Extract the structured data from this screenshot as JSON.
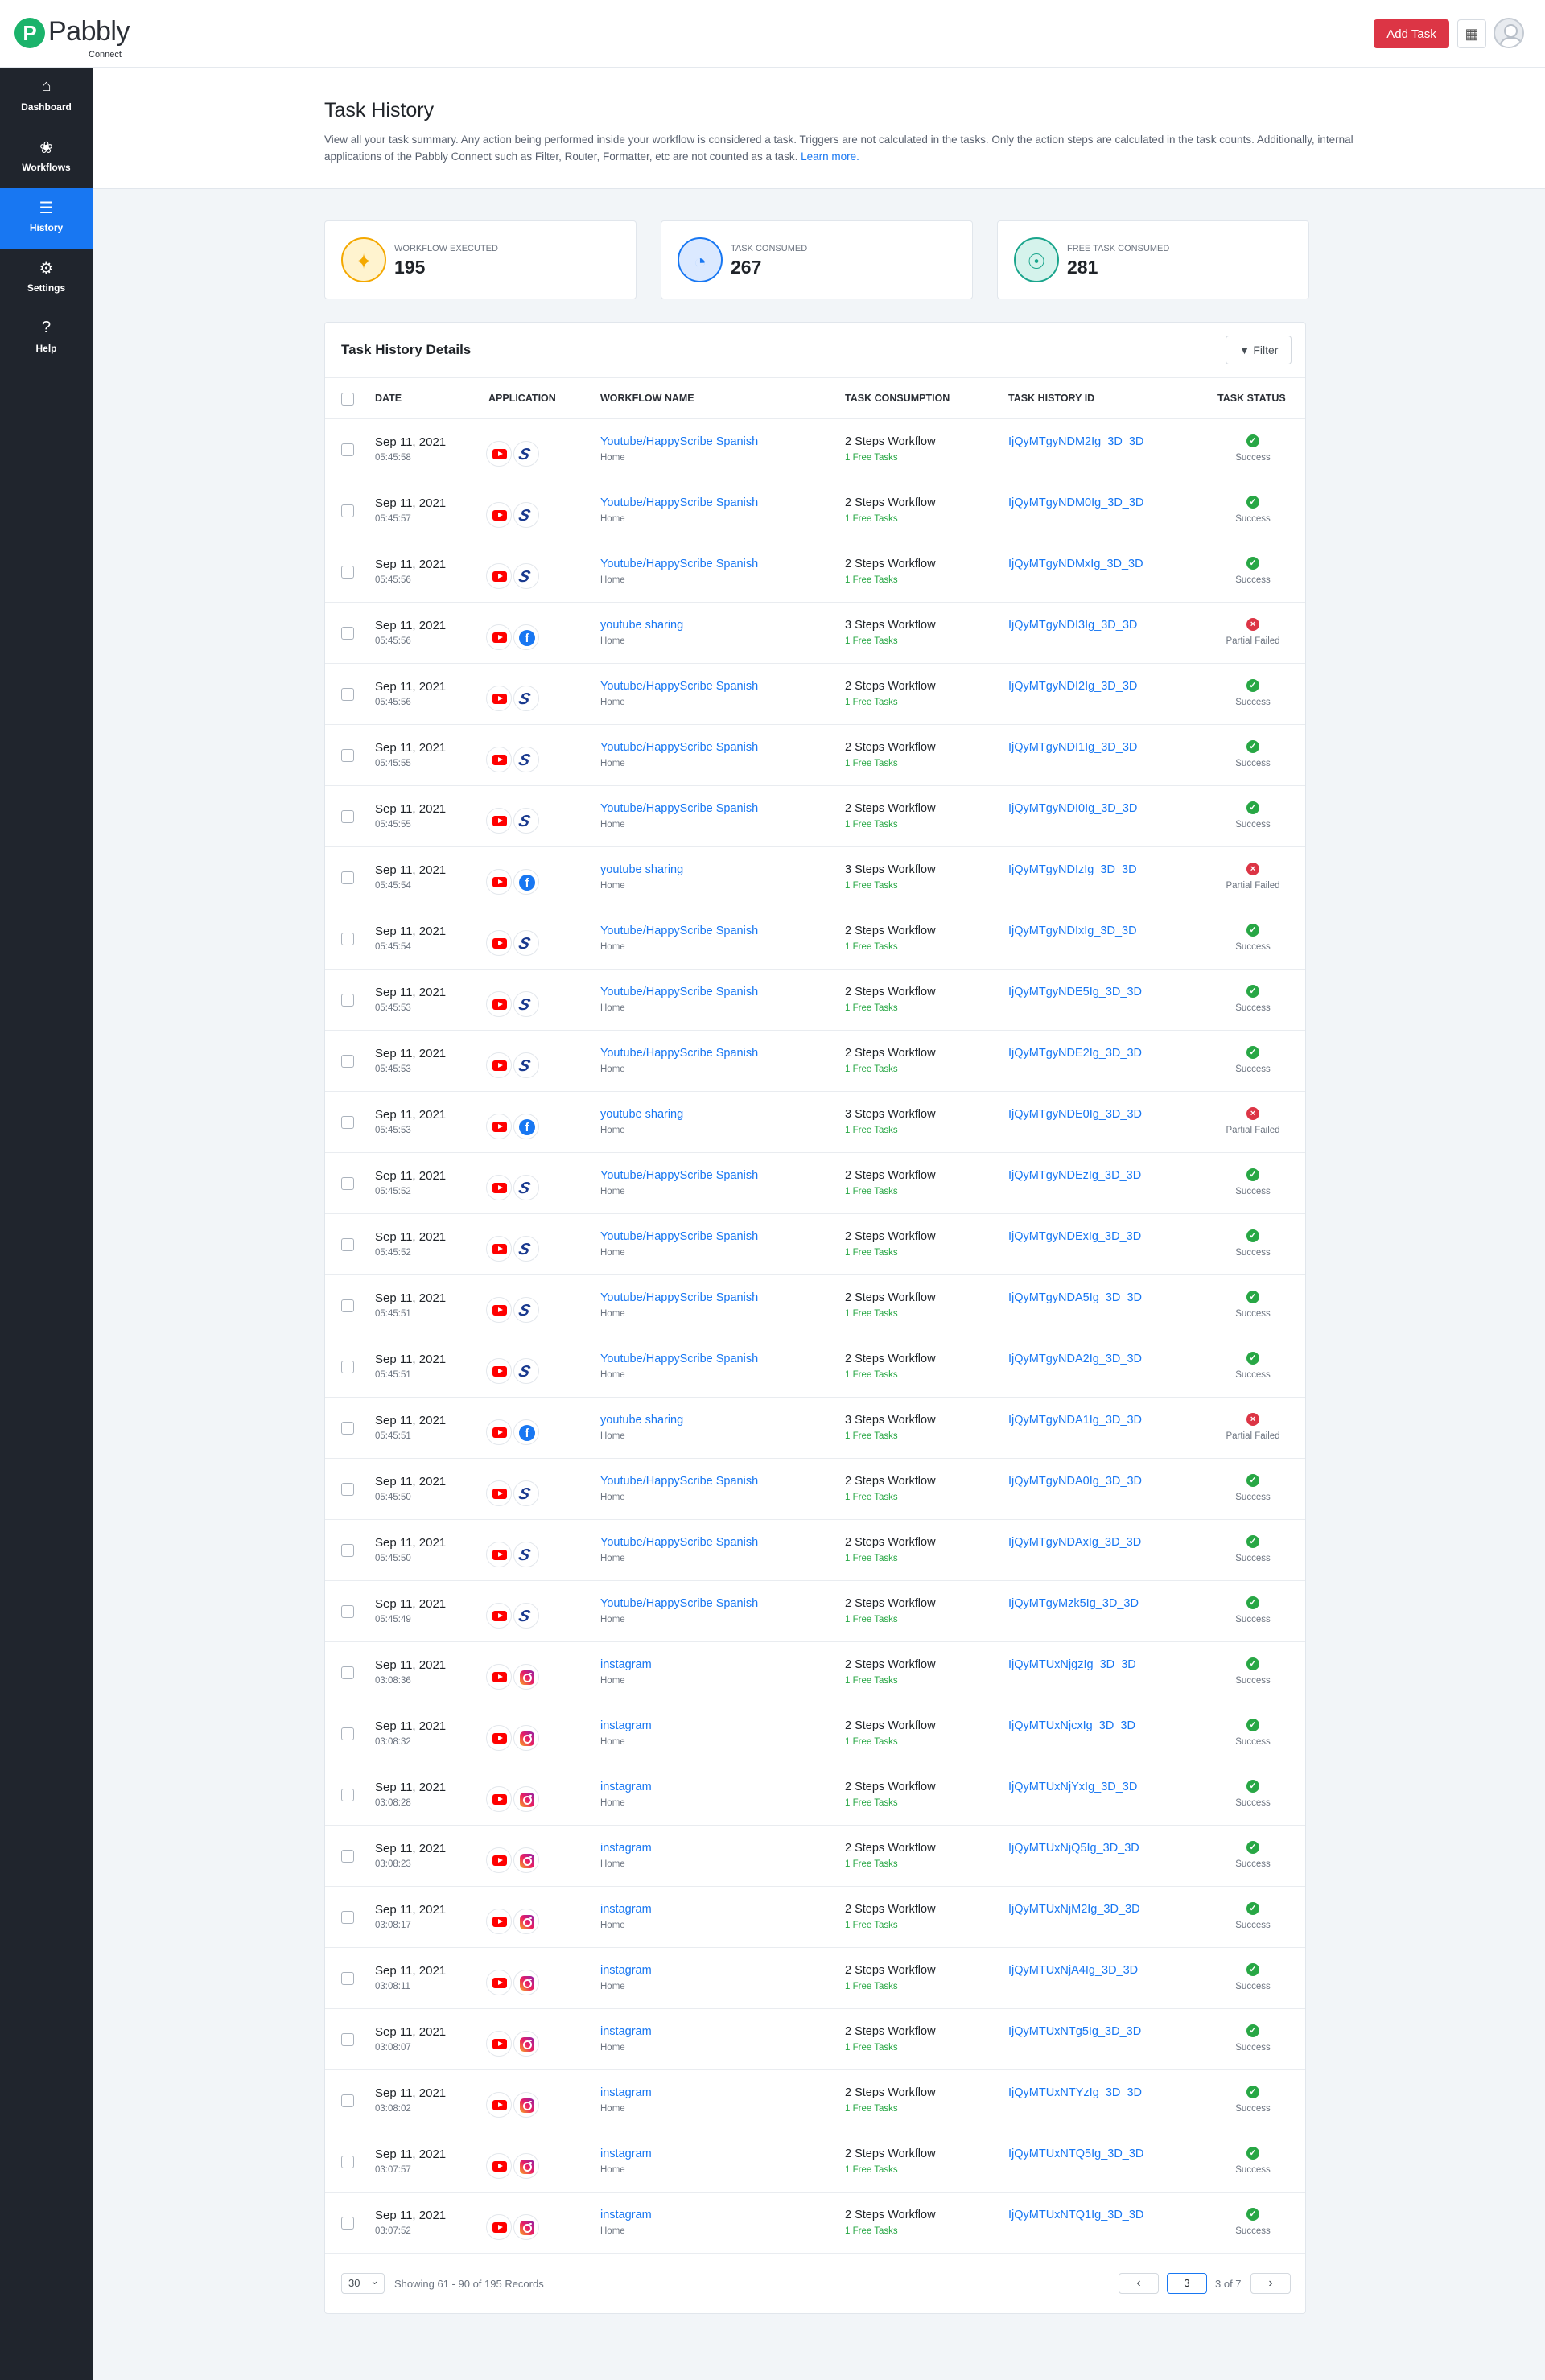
{
  "brand": {
    "name": "Pabbly",
    "sub": "Connect",
    "mark": "P"
  },
  "topbar": {
    "add_task_label": "Add Task",
    "apps_icon": "grid-icon",
    "avatar_icon": "user-avatar-icon"
  },
  "sidebar": {
    "items": [
      {
        "label": "Dashboard",
        "icon": "home-icon",
        "glyph": "⌂",
        "active": false
      },
      {
        "label": "Workflows",
        "icon": "workflow-icon",
        "glyph": "❀",
        "active": false
      },
      {
        "label": "History",
        "icon": "list-icon",
        "glyph": "☰",
        "active": true
      },
      {
        "label": "Settings",
        "icon": "gear-icon",
        "glyph": "⚙",
        "active": false
      },
      {
        "label": "Help",
        "icon": "question-icon",
        "glyph": "?",
        "active": false
      }
    ]
  },
  "header": {
    "title": "Task History",
    "description": "View all your task summary. Any action being performed inside your workflow is considered a task. Triggers are not calculated in the tasks. Only the action steps are calculated in the task counts. Additionally, internal applications of the Pabbly Connect such as Filter, Router, Formatter, etc are not counted as a task.",
    "learn_more": "Learn more."
  },
  "stats": [
    {
      "label": "Workflow Executed",
      "value": "195",
      "icon": "badge-check-icon",
      "color": "#f4a800",
      "bg": "#fff3cf"
    },
    {
      "label": "Task Consumed",
      "value": "267",
      "icon": "pie-chart-icon",
      "color": "#1877f2",
      "bg": "#dbe9ff"
    },
    {
      "label": "Free Task Consumed",
      "value": "281",
      "icon": "free-badge-icon",
      "color": "#1aa58c",
      "bg": "#d5f3ec"
    }
  ],
  "table": {
    "title": "Task History Details",
    "filter_label": "Filter",
    "columns": [
      "DATE",
      "APPLICATION",
      "WORKFLOW NAME",
      "TASK CONSUMPTION",
      "TASK HISTORY ID",
      "TASK STATUS"
    ],
    "rows": [
      {
        "date": "Sep 11, 2021",
        "time": "05:45:58",
        "apps": [
          "youtube",
          "happyscribe"
        ],
        "workflow": "Youtube/HappyScribe Spanish",
        "folder": "Home",
        "consumption": "2 Steps Workflow",
        "free": "1 Free Tasks",
        "id": "IjQyMTgyNDM2Ig_3D_3D",
        "status": "Success"
      },
      {
        "date": "Sep 11, 2021",
        "time": "05:45:57",
        "apps": [
          "youtube",
          "happyscribe"
        ],
        "workflow": "Youtube/HappyScribe Spanish",
        "folder": "Home",
        "consumption": "2 Steps Workflow",
        "free": "1 Free Tasks",
        "id": "IjQyMTgyNDM0Ig_3D_3D",
        "status": "Success"
      },
      {
        "date": "Sep 11, 2021",
        "time": "05:45:56",
        "apps": [
          "youtube",
          "happyscribe"
        ],
        "workflow": "Youtube/HappyScribe Spanish",
        "folder": "Home",
        "consumption": "2 Steps Workflow",
        "free": "1 Free Tasks",
        "id": "IjQyMTgyNDMxIg_3D_3D",
        "status": "Success"
      },
      {
        "date": "Sep 11, 2021",
        "time": "05:45:56",
        "apps": [
          "youtube",
          "facebook"
        ],
        "workflow": "youtube sharing",
        "folder": "Home",
        "consumption": "3 Steps Workflow",
        "free": "1 Free Tasks",
        "id": "IjQyMTgyNDI3Ig_3D_3D",
        "status": "Partial Failed"
      },
      {
        "date": "Sep 11, 2021",
        "time": "05:45:56",
        "apps": [
          "youtube",
          "happyscribe"
        ],
        "workflow": "Youtube/HappyScribe Spanish",
        "folder": "Home",
        "consumption": "2 Steps Workflow",
        "free": "1 Free Tasks",
        "id": "IjQyMTgyNDI2Ig_3D_3D",
        "status": "Success"
      },
      {
        "date": "Sep 11, 2021",
        "time": "05:45:55",
        "apps": [
          "youtube",
          "happyscribe"
        ],
        "workflow": "Youtube/HappyScribe Spanish",
        "folder": "Home",
        "consumption": "2 Steps Workflow",
        "free": "1 Free Tasks",
        "id": "IjQyMTgyNDI1Ig_3D_3D",
        "status": "Success"
      },
      {
        "date": "Sep 11, 2021",
        "time": "05:45:55",
        "apps": [
          "youtube",
          "happyscribe"
        ],
        "workflow": "Youtube/HappyScribe Spanish",
        "folder": "Home",
        "consumption": "2 Steps Workflow",
        "free": "1 Free Tasks",
        "id": "IjQyMTgyNDI0Ig_3D_3D",
        "status": "Success"
      },
      {
        "date": "Sep 11, 2021",
        "time": "05:45:54",
        "apps": [
          "youtube",
          "facebook"
        ],
        "workflow": "youtube sharing",
        "folder": "Home",
        "consumption": "3 Steps Workflow",
        "free": "1 Free Tasks",
        "id": "IjQyMTgyNDIzIg_3D_3D",
        "status": "Partial Failed"
      },
      {
        "date": "Sep 11, 2021",
        "time": "05:45:54",
        "apps": [
          "youtube",
          "happyscribe"
        ],
        "workflow": "Youtube/HappyScribe Spanish",
        "folder": "Home",
        "consumption": "2 Steps Workflow",
        "free": "1 Free Tasks",
        "id": "IjQyMTgyNDIxIg_3D_3D",
        "status": "Success"
      },
      {
        "date": "Sep 11, 2021",
        "time": "05:45:53",
        "apps": [
          "youtube",
          "happyscribe"
        ],
        "workflow": "Youtube/HappyScribe Spanish",
        "folder": "Home",
        "consumption": "2 Steps Workflow",
        "free": "1 Free Tasks",
        "id": "IjQyMTgyNDE5Ig_3D_3D",
        "status": "Success"
      },
      {
        "date": "Sep 11, 2021",
        "time": "05:45:53",
        "apps": [
          "youtube",
          "happyscribe"
        ],
        "workflow": "Youtube/HappyScribe Spanish",
        "folder": "Home",
        "consumption": "2 Steps Workflow",
        "free": "1 Free Tasks",
        "id": "IjQyMTgyNDE2Ig_3D_3D",
        "status": "Success"
      },
      {
        "date": "Sep 11, 2021",
        "time": "05:45:53",
        "apps": [
          "youtube",
          "facebook"
        ],
        "workflow": "youtube sharing",
        "folder": "Home",
        "consumption": "3 Steps Workflow",
        "free": "1 Free Tasks",
        "id": "IjQyMTgyNDE0Ig_3D_3D",
        "status": "Partial Failed"
      },
      {
        "date": "Sep 11, 2021",
        "time": "05:45:52",
        "apps": [
          "youtube",
          "happyscribe"
        ],
        "workflow": "Youtube/HappyScribe Spanish",
        "folder": "Home",
        "consumption": "2 Steps Workflow",
        "free": "1 Free Tasks",
        "id": "IjQyMTgyNDEzIg_3D_3D",
        "status": "Success"
      },
      {
        "date": "Sep 11, 2021",
        "time": "05:45:52",
        "apps": [
          "youtube",
          "happyscribe"
        ],
        "workflow": "Youtube/HappyScribe Spanish",
        "folder": "Home",
        "consumption": "2 Steps Workflow",
        "free": "1 Free Tasks",
        "id": "IjQyMTgyNDExIg_3D_3D",
        "status": "Success"
      },
      {
        "date": "Sep 11, 2021",
        "time": "05:45:51",
        "apps": [
          "youtube",
          "happyscribe"
        ],
        "workflow": "Youtube/HappyScribe Spanish",
        "folder": "Home",
        "consumption": "2 Steps Workflow",
        "free": "1 Free Tasks",
        "id": "IjQyMTgyNDA5Ig_3D_3D",
        "status": "Success"
      },
      {
        "date": "Sep 11, 2021",
        "time": "05:45:51",
        "apps": [
          "youtube",
          "happyscribe"
        ],
        "workflow": "Youtube/HappyScribe Spanish",
        "folder": "Home",
        "consumption": "2 Steps Workflow",
        "free": "1 Free Tasks",
        "id": "IjQyMTgyNDA2Ig_3D_3D",
        "status": "Success"
      },
      {
        "date": "Sep 11, 2021",
        "time": "05:45:51",
        "apps": [
          "youtube",
          "facebook"
        ],
        "workflow": "youtube sharing",
        "folder": "Home",
        "consumption": "3 Steps Workflow",
        "free": "1 Free Tasks",
        "id": "IjQyMTgyNDA1Ig_3D_3D",
        "status": "Partial Failed"
      },
      {
        "date": "Sep 11, 2021",
        "time": "05:45:50",
        "apps": [
          "youtube",
          "happyscribe"
        ],
        "workflow": "Youtube/HappyScribe Spanish",
        "folder": "Home",
        "consumption": "2 Steps Workflow",
        "free": "1 Free Tasks",
        "id": "IjQyMTgyNDA0Ig_3D_3D",
        "status": "Success"
      },
      {
        "date": "Sep 11, 2021",
        "time": "05:45:50",
        "apps": [
          "youtube",
          "happyscribe"
        ],
        "workflow": "Youtube/HappyScribe Spanish",
        "folder": "Home",
        "consumption": "2 Steps Workflow",
        "free": "1 Free Tasks",
        "id": "IjQyMTgyNDAxIg_3D_3D",
        "status": "Success"
      },
      {
        "date": "Sep 11, 2021",
        "time": "05:45:49",
        "apps": [
          "youtube",
          "happyscribe"
        ],
        "workflow": "Youtube/HappyScribe Spanish",
        "folder": "Home",
        "consumption": "2 Steps Workflow",
        "free": "1 Free Tasks",
        "id": "IjQyMTgyMzk5Ig_3D_3D",
        "status": "Success"
      },
      {
        "date": "Sep 11, 2021",
        "time": "03:08:36",
        "apps": [
          "youtube",
          "instagram"
        ],
        "workflow": "instagram",
        "folder": "Home",
        "consumption": "2 Steps Workflow",
        "free": "1 Free Tasks",
        "id": "IjQyMTUxNjgzIg_3D_3D",
        "status": "Success"
      },
      {
        "date": "Sep 11, 2021",
        "time": "03:08:32",
        "apps": [
          "youtube",
          "instagram"
        ],
        "workflow": "instagram",
        "folder": "Home",
        "consumption": "2 Steps Workflow",
        "free": "1 Free Tasks",
        "id": "IjQyMTUxNjcxIg_3D_3D",
        "status": "Success"
      },
      {
        "date": "Sep 11, 2021",
        "time": "03:08:28",
        "apps": [
          "youtube",
          "instagram"
        ],
        "workflow": "instagram",
        "folder": "Home",
        "consumption": "2 Steps Workflow",
        "free": "1 Free Tasks",
        "id": "IjQyMTUxNjYxIg_3D_3D",
        "status": "Success"
      },
      {
        "date": "Sep 11, 2021",
        "time": "03:08:23",
        "apps": [
          "youtube",
          "instagram"
        ],
        "workflow": "instagram",
        "folder": "Home",
        "consumption": "2 Steps Workflow",
        "free": "1 Free Tasks",
        "id": "IjQyMTUxNjQ5Ig_3D_3D",
        "status": "Success"
      },
      {
        "date": "Sep 11, 2021",
        "time": "03:08:17",
        "apps": [
          "youtube",
          "instagram"
        ],
        "workflow": "instagram",
        "folder": "Home",
        "consumption": "2 Steps Workflow",
        "free": "1 Free Tasks",
        "id": "IjQyMTUxNjM2Ig_3D_3D",
        "status": "Success"
      },
      {
        "date": "Sep 11, 2021",
        "time": "03:08:11",
        "apps": [
          "youtube",
          "instagram"
        ],
        "workflow": "instagram",
        "folder": "Home",
        "consumption": "2 Steps Workflow",
        "free": "1 Free Tasks",
        "id": "IjQyMTUxNjA4Ig_3D_3D",
        "status": "Success"
      },
      {
        "date": "Sep 11, 2021",
        "time": "03:08:07",
        "apps": [
          "youtube",
          "instagram"
        ],
        "workflow": "instagram",
        "folder": "Home",
        "consumption": "2 Steps Workflow",
        "free": "1 Free Tasks",
        "id": "IjQyMTUxNTg5Ig_3D_3D",
        "status": "Success"
      },
      {
        "date": "Sep 11, 2021",
        "time": "03:08:02",
        "apps": [
          "youtube",
          "instagram"
        ],
        "workflow": "instagram",
        "folder": "Home",
        "consumption": "2 Steps Workflow",
        "free": "1 Free Tasks",
        "id": "IjQyMTUxNTYzIg_3D_3D",
        "status": "Success"
      },
      {
        "date": "Sep 11, 2021",
        "time": "03:07:57",
        "apps": [
          "youtube",
          "instagram"
        ],
        "workflow": "instagram",
        "folder": "Home",
        "consumption": "2 Steps Workflow",
        "free": "1 Free Tasks",
        "id": "IjQyMTUxNTQ5Ig_3D_3D",
        "status": "Success"
      },
      {
        "date": "Sep 11, 2021",
        "time": "03:07:52",
        "apps": [
          "youtube",
          "instagram"
        ],
        "workflow": "instagram",
        "folder": "Home",
        "consumption": "2 Steps Workflow",
        "free": "1 Free Tasks",
        "id": "IjQyMTUxNTQ1Ig_3D_3D",
        "status": "Success"
      }
    ]
  },
  "footer": {
    "per_page": "30",
    "showing": "Showing 61 - 90 of 195 Records",
    "page": "3",
    "of_pages": "3 of 7",
    "prev_icon": "chevron-left-icon",
    "next_icon": "chevron-right-icon"
  },
  "colors": {
    "brand_green": "#1bb36b",
    "accent_blue": "#1877f2",
    "danger_red": "#dc3545",
    "success_green": "#28a745",
    "sidebar_bg": "#20252d"
  }
}
